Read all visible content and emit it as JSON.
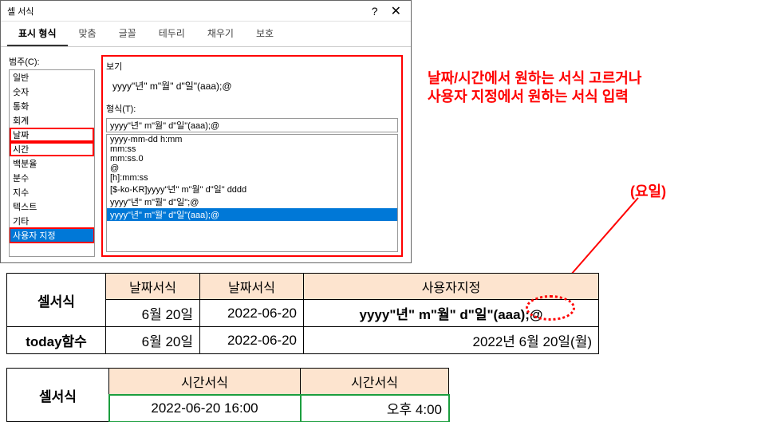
{
  "dialog": {
    "title": "셀 서식",
    "help": "?",
    "close": "✕",
    "tabs": [
      "표시 형식",
      "맞춤",
      "글꼴",
      "테두리",
      "채우기",
      "보호"
    ],
    "category_label": "범주(C):",
    "categories": [
      "일반",
      "숫자",
      "통화",
      "회계",
      "날짜",
      "시간",
      "백분율",
      "분수",
      "지수",
      "텍스트",
      "기타",
      "사용자 지정"
    ],
    "preview_label": "보기",
    "preview_value": "yyyy\"년\" m\"월\" d\"일\"(aaa);@",
    "format_label": "형식(T):",
    "format_value": "yyyy\"년\" m\"월\" d\"일\"(aaa);@",
    "format_list": [
      "yyyy-mm-dd h:mm",
      "mm:ss",
      "mm:ss.0",
      "@",
      "[h]:mm:ss",
      "[$-ko-KR]yyyy\"년\" m\"월\" d\"일\" dddd",
      "yyyy\"년\" m\"월\" d\"일\";@",
      "yyyy\"년\" m\"월\" d\"일\"(aaa);@"
    ]
  },
  "annotations": {
    "line1": "날짜/시간에서 원하는 서식 고르거나",
    "line2": "사용자 지정에서 원하는 서식 입력",
    "dayofweek": "(요일)"
  },
  "table1": {
    "r1": [
      "셀서식",
      "날짜서식",
      "날짜서식",
      "사용자지정"
    ],
    "r2": [
      "6월 20일",
      "2022-06-20",
      "yyyy\"년\" m\"월\" d\"일\"(aaa);@"
    ],
    "r3": [
      "today함수",
      "6월 20일",
      "2022-06-20",
      "2022년 6월 20일(월)"
    ]
  },
  "table2": {
    "r1": [
      "셀서식",
      "시간서식",
      "시간서식"
    ],
    "r2": [
      "2022-06-20 16:00",
      "오후 4:00"
    ]
  }
}
